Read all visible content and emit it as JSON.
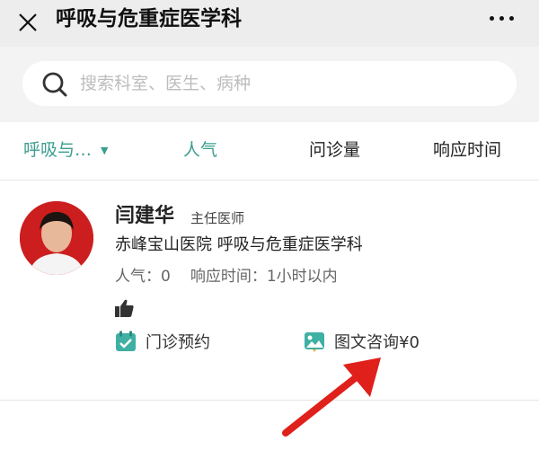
{
  "header": {
    "title": "呼吸与危重症医学科",
    "close_icon": "close-icon",
    "more_icon": "more-icon"
  },
  "search": {
    "placeholder": "搜索科室、医生、病种"
  },
  "filters": {
    "department": "呼吸与…",
    "popularity": "人气",
    "consult_volume": "问诊量",
    "response_time": "响应时间"
  },
  "doctor": {
    "name": "闫建华",
    "title": "主任医师",
    "hospital": "赤峰宝山医院 呼吸与危重症医学科",
    "popularity_label": "人气：",
    "popularity_value": "0",
    "response_label": "响应时间：",
    "response_value": "1小时以内",
    "clinic_label": "门诊预约",
    "text_consult_label": "图文咨询¥0"
  },
  "colors": {
    "accent": "#3b9e8f",
    "arrow": "#e0201b"
  }
}
